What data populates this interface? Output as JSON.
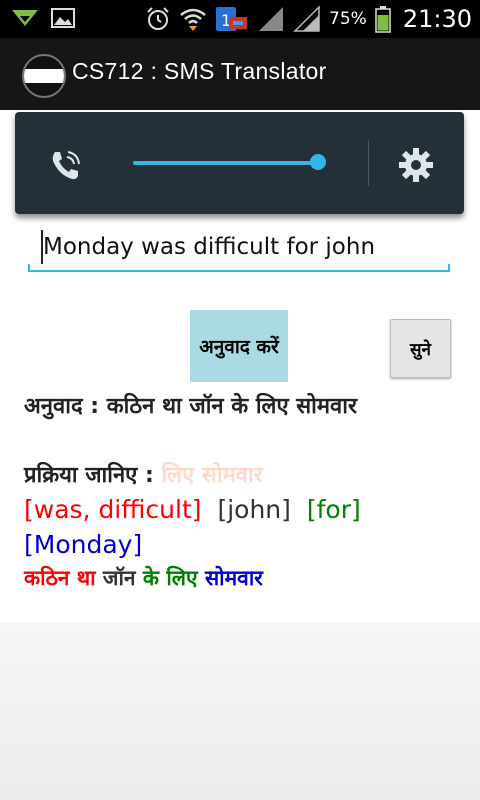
{
  "status_bar": {
    "battery_percent": "75%",
    "time": "21:30",
    "icons": [
      "wifi-arrow-icon",
      "image-icon",
      "alarm-icon",
      "wifi-icon",
      "notification-icon",
      "signal-icon",
      "signal-icon",
      "battery-icon"
    ]
  },
  "action_bar": {
    "title": "CS712 : SMS Translator"
  },
  "controls_panel": {
    "icons": [
      "phone-volume-icon",
      "gear-icon"
    ],
    "slider_level": 1.0
  },
  "input": {
    "value": "Monday was difficult for john"
  },
  "buttons": {
    "translate": "अनुवाद करें",
    "listen": "सुने"
  },
  "result": {
    "label": "अनुवाद : कठिन था जॉन के लिए सोमवार"
  },
  "process": {
    "label": "प्रक्रिया जानिए :",
    "faded_text": "लिए सोमवार"
  },
  "tokens": [
    {
      "text": "[was, difficult]",
      "color": "#ff0000"
    },
    {
      "text": "[john]",
      "color": "#333333"
    },
    {
      "text": "[for]",
      "color": "#008000"
    },
    {
      "text": "[Monday]",
      "color": "#0000cc"
    }
  ],
  "hindi_segments": [
    {
      "text": "कठिन था ",
      "color": "#ff0000"
    },
    {
      "text": "जॉन ",
      "color": "#333333"
    },
    {
      "text": "के लिए ",
      "color": "#008000"
    },
    {
      "text": "सोमवार",
      "color": "#0000cc"
    }
  ]
}
